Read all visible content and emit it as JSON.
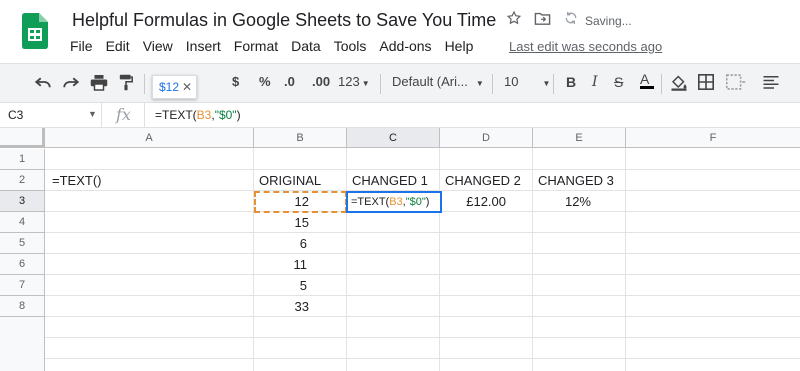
{
  "app": {
    "title": "Helpful Formulas in Google Sheets to Save You Time",
    "saving": "Saving...",
    "last_edit": "Last edit was seconds ago"
  },
  "menu": [
    "File",
    "Edit",
    "View",
    "Insert",
    "Format",
    "Data",
    "Tools",
    "Add-ons",
    "Help"
  ],
  "toolbar": {
    "dollar": "$",
    "percent": "%",
    "decimal_decrease": ".0",
    "decimal_increase": ".00",
    "number_format": "123",
    "font": "Default (Ari...",
    "font_size": "10",
    "tooltip_value": "$12"
  },
  "formula_bar": {
    "name_box": "C3",
    "fx": "fx",
    "formula_prefix": "=TEXT(",
    "formula_ref": "B3",
    "formula_mid": ",",
    "formula_str": "\"$0\"",
    "formula_suffix": ")"
  },
  "grid": {
    "columns": [
      "A",
      "B",
      "C",
      "D",
      "E",
      "F"
    ],
    "rows": [
      "1",
      "2",
      "3",
      "4",
      "5",
      "6",
      "7",
      "8"
    ],
    "a2": "=TEXT()",
    "b2": "ORIGINAL",
    "c2": "CHANGED 1",
    "d2": "CHANGED 2",
    "e2": "CHANGED 3",
    "b_values": [
      "12",
      "15",
      "6",
      "11",
      "5",
      "33"
    ],
    "d3": "£12.00",
    "e3": "12%",
    "active_cell_prefix": "=TEXT(",
    "active_cell_ref": "B3",
    "active_cell_mid": ",",
    "active_cell_str": "\"$0\"",
    "active_cell_suffix": ")"
  },
  "colors": {
    "sheets_green": "#0f9d58",
    "reference_orange": "#e69138",
    "string_green": "#0b8043",
    "selection_blue": "#1a73e8"
  }
}
